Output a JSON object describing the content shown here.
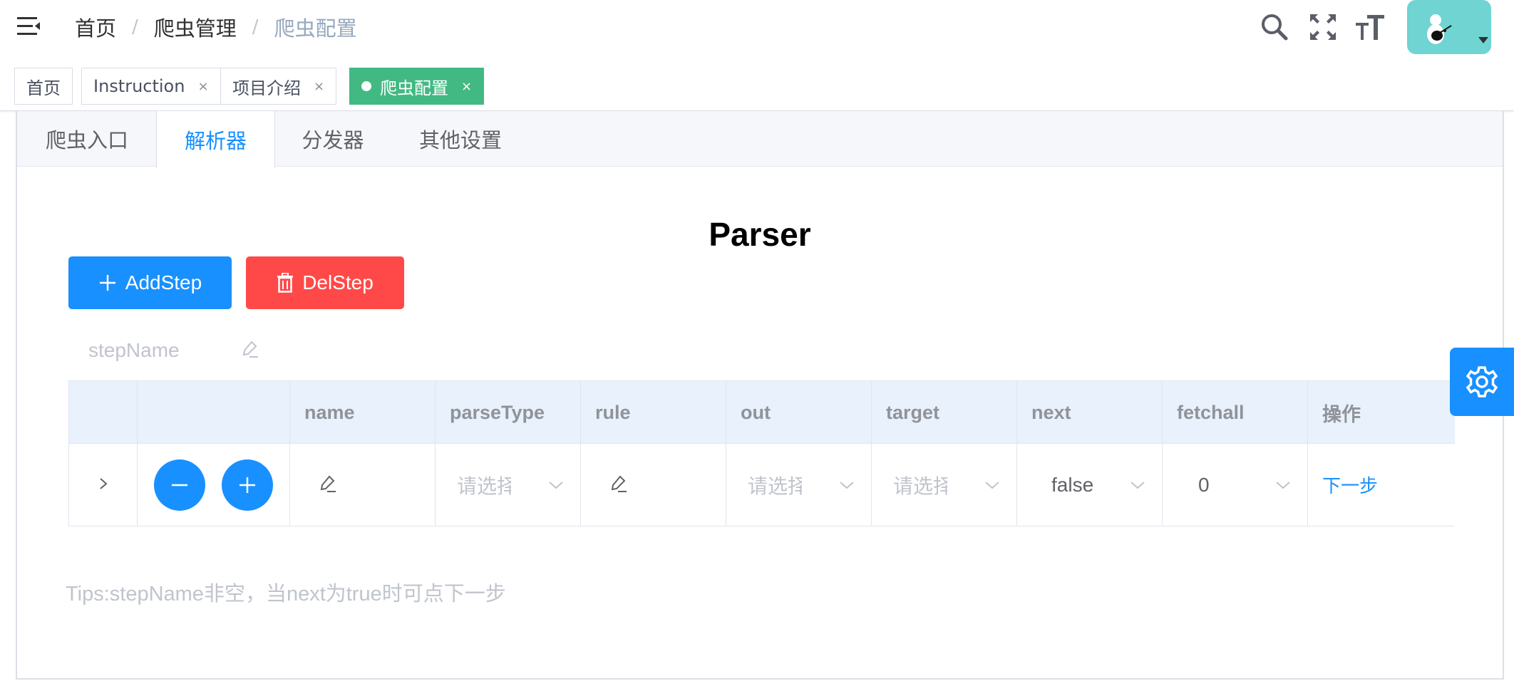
{
  "breadcrumb": [
    "首页",
    "爬虫管理",
    "爬虫配置"
  ],
  "tags": [
    {
      "label": "首页",
      "closable": false,
      "active": false
    },
    {
      "label": "Instruction",
      "closable": true,
      "active": false
    },
    {
      "label": "项目介绍",
      "closable": true,
      "active": false
    },
    {
      "label": "爬虫配置",
      "closable": true,
      "active": true
    }
  ],
  "tag_close_glyph": "×",
  "tabs": [
    "爬虫入口",
    "解析器",
    "分发器",
    "其他设置"
  ],
  "active_tab": "解析器",
  "title": "Parser",
  "buttons": {
    "add": "AddStep",
    "del": "DelStep"
  },
  "stepname_placeholder": "stepName",
  "table": {
    "columns": [
      "",
      "",
      "name",
      "parseType",
      "rule",
      "out",
      "target",
      "next",
      "fetchall",
      "操作"
    ],
    "row": {
      "parseType_placeholder": "请选择",
      "out_placeholder": "请选择",
      "target_placeholder": "请选择",
      "next": "false",
      "fetchall": "0",
      "action": "下一步"
    }
  },
  "tips": "Tips:stepName非空，当next为true时可点下一步",
  "colors": {
    "primary": "#1890ff",
    "danger": "#ff4949",
    "active_tag": "#42b983",
    "avatar_bg": "#6fd4d2"
  },
  "icons": {
    "menu": "hamburger-icon",
    "search": "search-icon",
    "fullscreen": "fullscreen-icon",
    "font_size": "font-size-icon",
    "settings": "gear-icon",
    "edit": "edit-icon",
    "expand": "chevron-right-icon",
    "minus": "minus-icon",
    "plus": "plus-icon",
    "trash": "trash-icon",
    "select_caret": "chevron-down-icon"
  }
}
